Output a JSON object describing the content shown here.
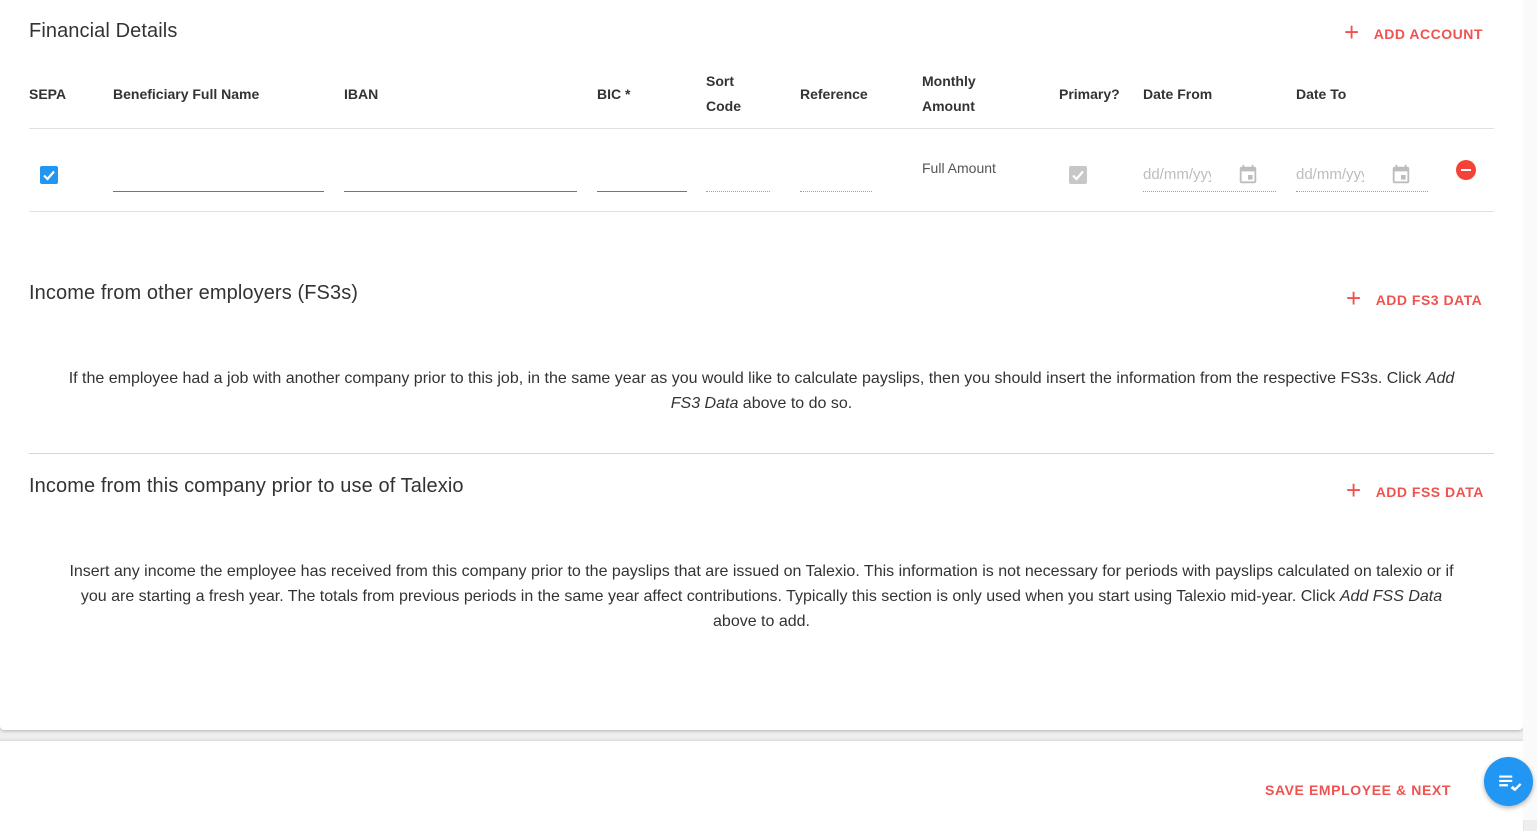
{
  "financial": {
    "title": "Financial Details",
    "add_label": "ADD ACCOUNT",
    "columns": {
      "sepa": "SEPA",
      "beneficiary": "Beneficiary Full Name",
      "iban": "IBAN",
      "bic": "BIC *",
      "sort_code_1": "Sort",
      "sort_code_2": "Code",
      "reference": "Reference",
      "monthly_1": "Monthly",
      "monthly_2": "Amount",
      "primary": "Primary?",
      "date_from": "Date From",
      "date_to": "Date To"
    },
    "row": {
      "sepa_checked": true,
      "beneficiary": "",
      "iban": "",
      "bic": "",
      "sort_code": "",
      "reference": "",
      "monthly_amount": "Full Amount",
      "primary_checked": true,
      "date_from_placeholder": "dd/mm/yyyy",
      "date_to_placeholder": "dd/mm/yyyy"
    }
  },
  "fs3": {
    "title": "Income from other employers (FS3s)",
    "add_label": "ADD FS3 DATA",
    "text_before": "If the employee had a job with another company prior to this job, in the same year as you would like to calculate payslips, then you should insert the information from the respective FS3s. Click ",
    "text_em": "Add FS3 Data",
    "text_after": " above to do so."
  },
  "fss": {
    "title": "Income from this company prior to use of Talexio",
    "add_label": "ADD FSS DATA",
    "text_before": "Insert any income the employee has received from this company prior to the payslips that are issued on Talexio. This information is not necessary for periods with payslips calculated on talexio or if you are starting a fresh year. The totals from previous periods in the same year affect contributions. Typically this section is only used when you start using Talexio mid-year. Click ",
    "text_em": "Add FSS Data",
    "text_after": " above to add."
  },
  "footer": {
    "save_label": "SAVE EMPLOYEE & NEXT"
  },
  "colors": {
    "accent": "#ef5350",
    "checkbox": "#2196f3",
    "fab": "#2196f3",
    "remove": "#f44336"
  },
  "icons": {
    "add": "plus-icon",
    "calendar": "calendar-icon",
    "remove": "minus-circle-icon",
    "fab": "checklist-icon"
  }
}
